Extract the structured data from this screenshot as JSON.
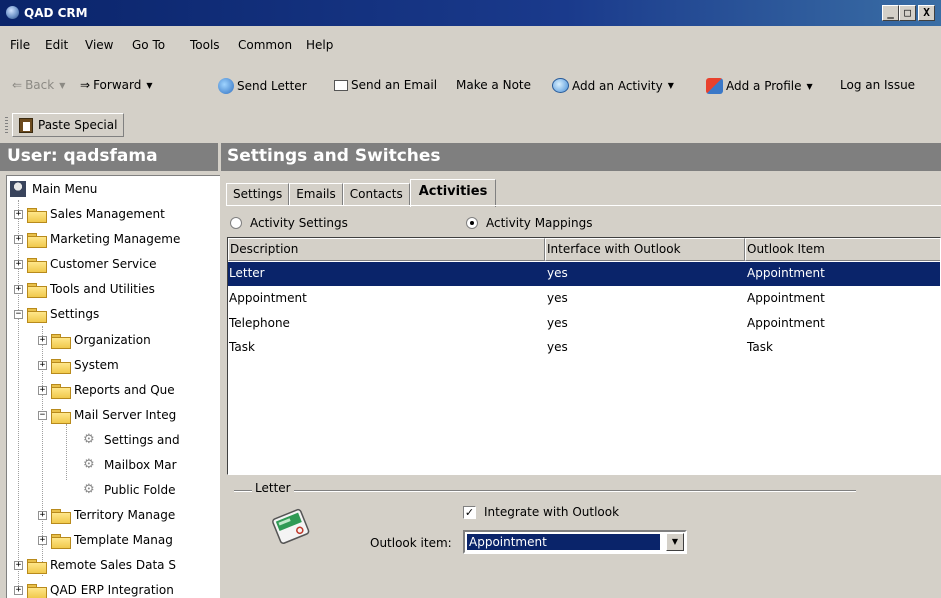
{
  "window": {
    "title": "QAD CRM",
    "buttons": [
      "_",
      "□",
      "X"
    ]
  },
  "menu": [
    "File",
    "Edit",
    "View",
    "Go To",
    "Tools",
    "Common",
    "Help"
  ],
  "toolbar": {
    "back": "Back",
    "forward": "Forward",
    "send_letter": "Send Letter",
    "send_email": "Send an Email",
    "make_note": "Make a Note",
    "add_activity": "Add an Activity",
    "add_profile": "Add a Profile",
    "log_issue": "Log an Issue",
    "paste_special": "Paste Special"
  },
  "left_header": "User: qadsfama",
  "right_header": "Settings and Switches",
  "tree": [
    {
      "label": "Main Menu"
    },
    {
      "label": "Sales Management"
    },
    {
      "label": "Marketing Manageme"
    },
    {
      "label": "Customer Service"
    },
    {
      "label": "Tools and Utilities"
    },
    {
      "label": "Settings"
    },
    {
      "label": "Organization"
    },
    {
      "label": "System"
    },
    {
      "label": "Reports and Que"
    },
    {
      "label": "Mail Server Integ"
    },
    {
      "label": "Settings and"
    },
    {
      "label": "Mailbox Mar"
    },
    {
      "label": "Public Folde"
    },
    {
      "label": "Territory Manage"
    },
    {
      "label": "Template Manag"
    },
    {
      "label": "Remote Sales Data S"
    },
    {
      "label": "QAD ERP Integration"
    }
  ],
  "tabs": [
    "Settings",
    "Emails",
    "Contacts",
    "Activities"
  ],
  "radios": {
    "activity_settings": "Activity Settings",
    "activity_mappings": "Activity Mappings"
  },
  "grid": {
    "columns": [
      "Description",
      "Interface with Outlook",
      "Outlook Item"
    ],
    "rows": [
      [
        "Letter",
        "yes",
        "Appointment"
      ],
      [
        "Appointment",
        "yes",
        "Appointment"
      ],
      [
        "Telephone",
        "yes",
        "Appointment"
      ],
      [
        "Task",
        "yes",
        "Task"
      ]
    ]
  },
  "detail": {
    "group_label": "Letter",
    "integrate_label": "Integrate with Outlook",
    "integrate_checked": "✓",
    "outlook_item_label": "Outlook item:",
    "outlook_item_value": "Appointment"
  },
  "colors": {
    "selection": "#0a246a",
    "header_bar": "#7f7f7f",
    "face": "#d4d0c8"
  }
}
